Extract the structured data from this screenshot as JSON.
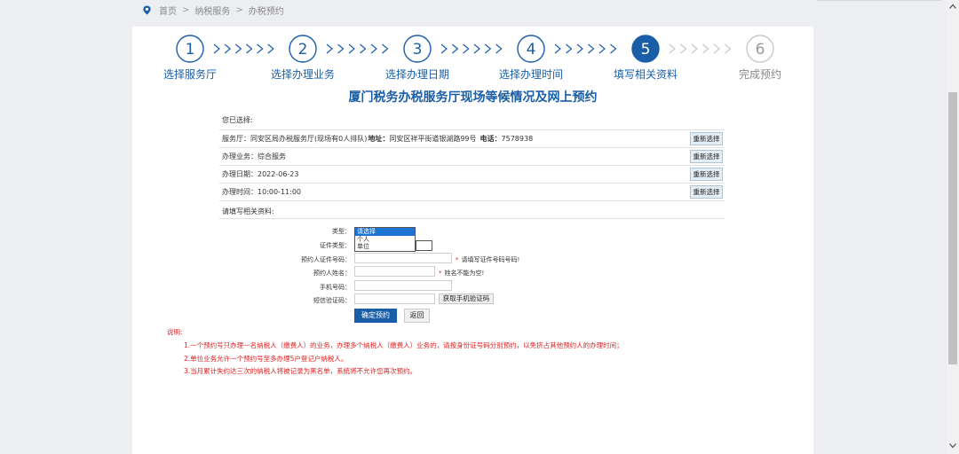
{
  "breadcrumb": {
    "home": "首页",
    "sep": ">",
    "service": "纳税服务",
    "current": "办税预约"
  },
  "steps": [
    {
      "num": "1",
      "label": "选择服务厅",
      "state": "done"
    },
    {
      "num": "2",
      "label": "选择办理业务",
      "state": "done"
    },
    {
      "num": "3",
      "label": "选择办理日期",
      "state": "done"
    },
    {
      "num": "4",
      "label": "选择办理时间",
      "state": "done"
    },
    {
      "num": "5",
      "label": "填写相关资料",
      "state": "active"
    },
    {
      "num": "6",
      "label": "完成预约",
      "state": "pending"
    }
  ],
  "title": "厦门税务办税服务厅现场等候情况及网上预约",
  "selected": {
    "heading": "您已选择:",
    "hall": {
      "prefix": "服务厅：同安区局办税服务厅(现场有0人排队)",
      "addr_label": "地址：",
      "addr": "同安区祥平街道银湖路99号",
      "tel_label": "电话：",
      "tel": "7578938"
    },
    "business": "办理业务：综合服务",
    "date": "办理日期：2022-06-23",
    "time": "办理时间：10:00-11:00",
    "reselect": "重新选择"
  },
  "form": {
    "heading": "请填写相关资料:",
    "type_label": "类型：",
    "type_options": [
      "请选择",
      "个人",
      "单位"
    ],
    "id_type_label": "证件类型：",
    "id_number_label": "预约人证件号码：",
    "id_number_hint": "请填写证件号码号码!",
    "name_label": "预约人姓名：",
    "name_hint": "姓名不能为空!",
    "phone_label": "手机号码：",
    "sms_label": "短信验证码：",
    "sms_button": "获取手机验证码",
    "submit": "确定预约",
    "back": "返回"
  },
  "notes": {
    "heading": "说明:",
    "items": [
      "1.一个预约号只办理一名纳税人（缴费人）的业务，办理多个纳税人（缴费人）业务的，请按身份证号码分别预约，以免挤占其他预约人的办理时间；",
      "2.单位业务允许一个预约号至多办理5户登记户纳税人。",
      "3.当月累计失约达三次的纳税人将被记录为黑名单，系统将不允许您再次预约。"
    ]
  },
  "colors": {
    "primary": "#1a5ea8",
    "warning": "#e02020",
    "pending": "#999999"
  }
}
